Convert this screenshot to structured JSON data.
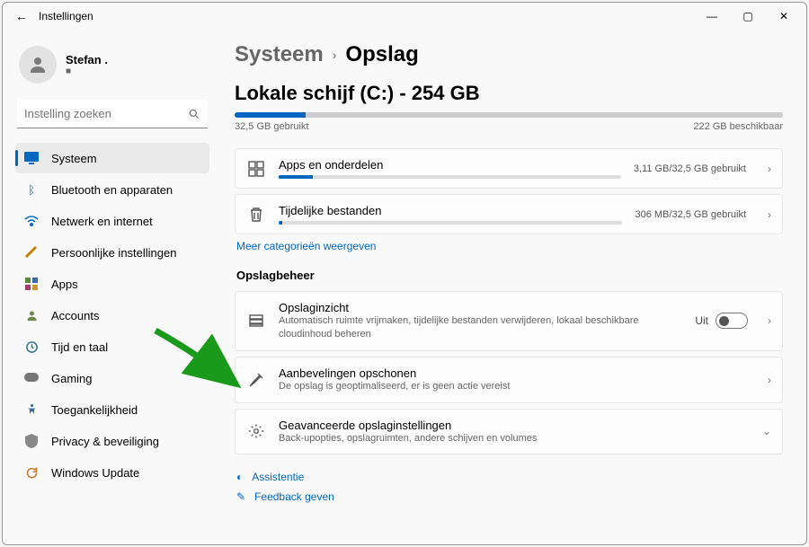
{
  "titlebar": {
    "title": "Instellingen"
  },
  "user": {
    "name": "Stefan ."
  },
  "search": {
    "placeholder": "Instelling zoeken"
  },
  "nav": {
    "items": [
      {
        "label": "Systeem"
      },
      {
        "label": "Bluetooth en apparaten"
      },
      {
        "label": "Netwerk en internet"
      },
      {
        "label": "Persoonlijke instellingen"
      },
      {
        "label": "Apps"
      },
      {
        "label": "Accounts"
      },
      {
        "label": "Tijd en taal"
      },
      {
        "label": "Gaming"
      },
      {
        "label": "Toegankelijkheid"
      },
      {
        "label": "Privacy & beveiliging"
      },
      {
        "label": "Windows Update"
      }
    ]
  },
  "breadcrumb": {
    "parent": "Systeem",
    "current": "Opslag"
  },
  "disk": {
    "title": "Lokale schijf (C:) - 254 GB",
    "used_label": "32,5 GB gebruikt",
    "free_label": "222 GB beschikbaar",
    "used_percent": 13
  },
  "usage": {
    "apps": {
      "title": "Apps en onderdelen",
      "right": "3,11 GB/32,5 GB gebruikt",
      "percent": 10
    },
    "temp": {
      "title": "Tijdelijke bestanden",
      "right": "306 MB/32,5 GB gebruikt",
      "percent": 1
    }
  },
  "more_link": "Meer categorieën weergeven",
  "management": {
    "heading": "Opslagbeheer",
    "sense": {
      "title": "Opslaginzicht",
      "sub": "Automatisch ruimte vrijmaken, tijdelijke bestanden verwijderen, lokaal beschikbare cloudinhoud beheren",
      "state": "Uit"
    },
    "cleanup": {
      "title": "Aanbevelingen opschonen",
      "sub": "De opslag is geoptimaliseerd, er is geen actie vereist"
    },
    "advanced": {
      "title": "Geavanceerde opslaginstellingen",
      "sub": "Back-upopties, opslagruimten, andere schijven en volumes"
    }
  },
  "footer": {
    "assist": "Assistentie",
    "feedback": "Feedback geven"
  }
}
